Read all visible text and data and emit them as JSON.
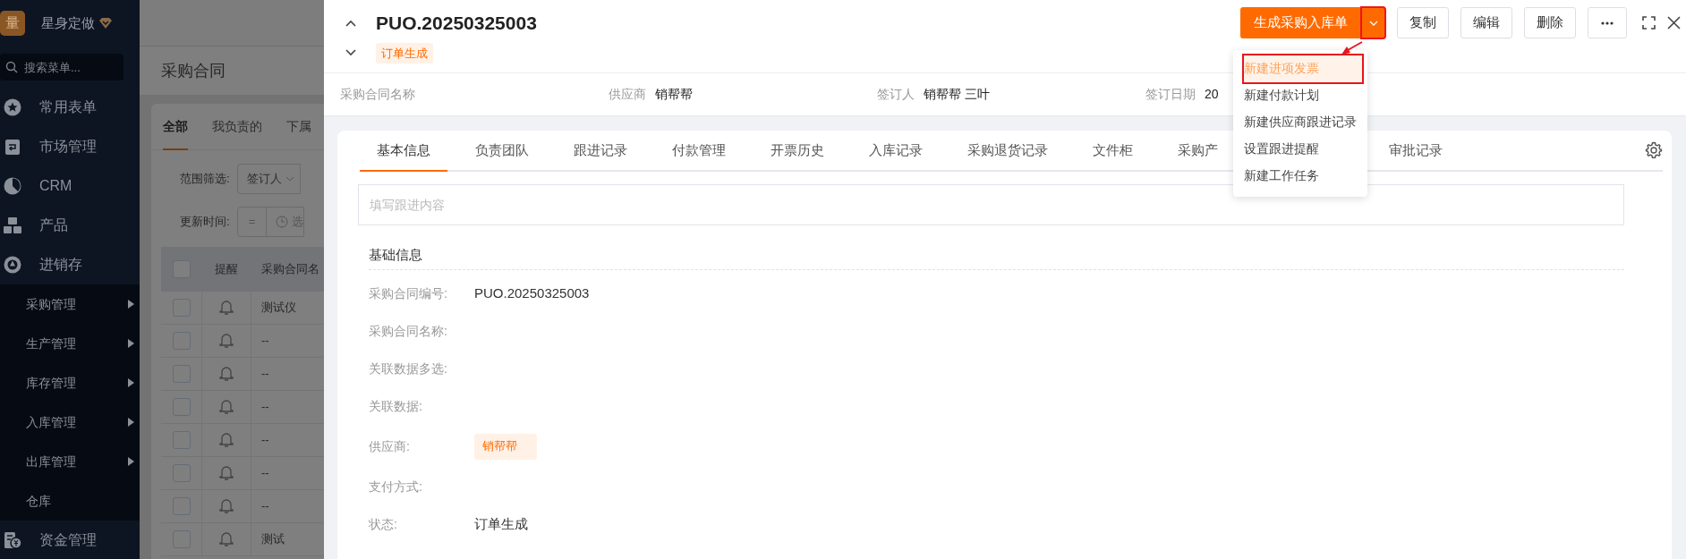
{
  "sidebar": {
    "logo": "量",
    "brand": "星身定做",
    "search": {
      "placeholder": "搜索菜单..."
    },
    "items": [
      {
        "label": "常用表单"
      },
      {
        "label": "市场管理"
      },
      {
        "label": "CRM"
      },
      {
        "label": "产品"
      },
      {
        "label": "进销存",
        "children": [
          {
            "label": "采购管理",
            "kind": "submenu"
          },
          {
            "label": "生产管理",
            "kind": "submenu"
          },
          {
            "label": "库存管理",
            "kind": "submenu"
          },
          {
            "label": "入库管理",
            "kind": "submenu"
          },
          {
            "label": "出库管理",
            "kind": "submenu"
          },
          {
            "label": "仓库",
            "kind": "link"
          }
        ]
      },
      {
        "label": "资金管理"
      }
    ]
  },
  "list_page": {
    "title": "采购合同",
    "tabs": [
      {
        "label": "全部",
        "selected": true
      },
      {
        "label": "我负责的",
        "selected": false
      },
      {
        "label": "下属",
        "selected": false
      }
    ],
    "filters": [
      {
        "label": "范围筛选:",
        "value": "签订人"
      },
      {
        "label": "更新时间:",
        "operator": "=",
        "placeholder": "选"
      }
    ],
    "table": {
      "all_checked": false,
      "columns": [
        "提醒",
        "采购合同名"
      ],
      "rows": [
        {
          "checked": false,
          "name": "测试仪"
        },
        {
          "checked": false,
          "name": "--"
        },
        {
          "checked": false,
          "name": "--"
        },
        {
          "checked": false,
          "name": "--"
        },
        {
          "checked": false,
          "name": "--"
        },
        {
          "checked": false,
          "name": "--"
        },
        {
          "checked": false,
          "name": "--"
        },
        {
          "checked": false,
          "name": "测试"
        }
      ]
    }
  },
  "drawer": {
    "title": "PUO.20250325003",
    "status": "订单生成",
    "actions": {
      "primary": "生成采购入库单",
      "caret_highlighted": true,
      "buttons": [
        "复制",
        "编辑",
        "删除"
      ]
    },
    "menu": [
      {
        "label": "新建进项发票",
        "hovered": true,
        "highlighted": true
      },
      {
        "label": "新建付款计划",
        "hovered": false,
        "highlighted": false
      },
      {
        "label": "新建供应商跟进记录",
        "hovered": false,
        "highlighted": false
      },
      {
        "label": "设置跟进提醒",
        "hovered": false,
        "highlighted": false
      },
      {
        "label": "新建工作任务",
        "hovered": false,
        "highlighted": false
      }
    ],
    "summary": [
      {
        "label": "采购合同名称"
      },
      {
        "label": "供应商",
        "value": "销帮帮"
      },
      {
        "label": "签订人",
        "value": "销帮帮 三叶"
      },
      {
        "label": "签订日期",
        "value": "20"
      }
    ],
    "tabs": [
      {
        "label": "基本信息",
        "selected": true
      },
      {
        "label": "负责团队",
        "selected": false
      },
      {
        "label": "跟进记录",
        "selected": false
      },
      {
        "label": "付款管理",
        "selected": false
      },
      {
        "label": "开票历史",
        "selected": false
      },
      {
        "label": "入库记录",
        "selected": false
      },
      {
        "label": "采购退货记录",
        "selected": false
      },
      {
        "label": "文件柜",
        "selected": false
      },
      {
        "label": "采购产",
        "selected": false
      },
      {
        "label": "审批记录",
        "selected": false
      }
    ],
    "follow_up": {
      "placeholder": "填写跟进内容"
    },
    "section_title": "基础信息",
    "fields": [
      {
        "label": "采购合同编号:",
        "value": "PUO.20250325003"
      },
      {
        "label": "采购合同名称:"
      },
      {
        "label": "关联数据多选:"
      },
      {
        "label": "关联数据:"
      },
      {
        "label": "供应商:",
        "tags": [
          "销帮帮"
        ]
      },
      {
        "label": "支付方式:"
      },
      {
        "label": "状态:",
        "value": "订单生成"
      }
    ]
  }
}
